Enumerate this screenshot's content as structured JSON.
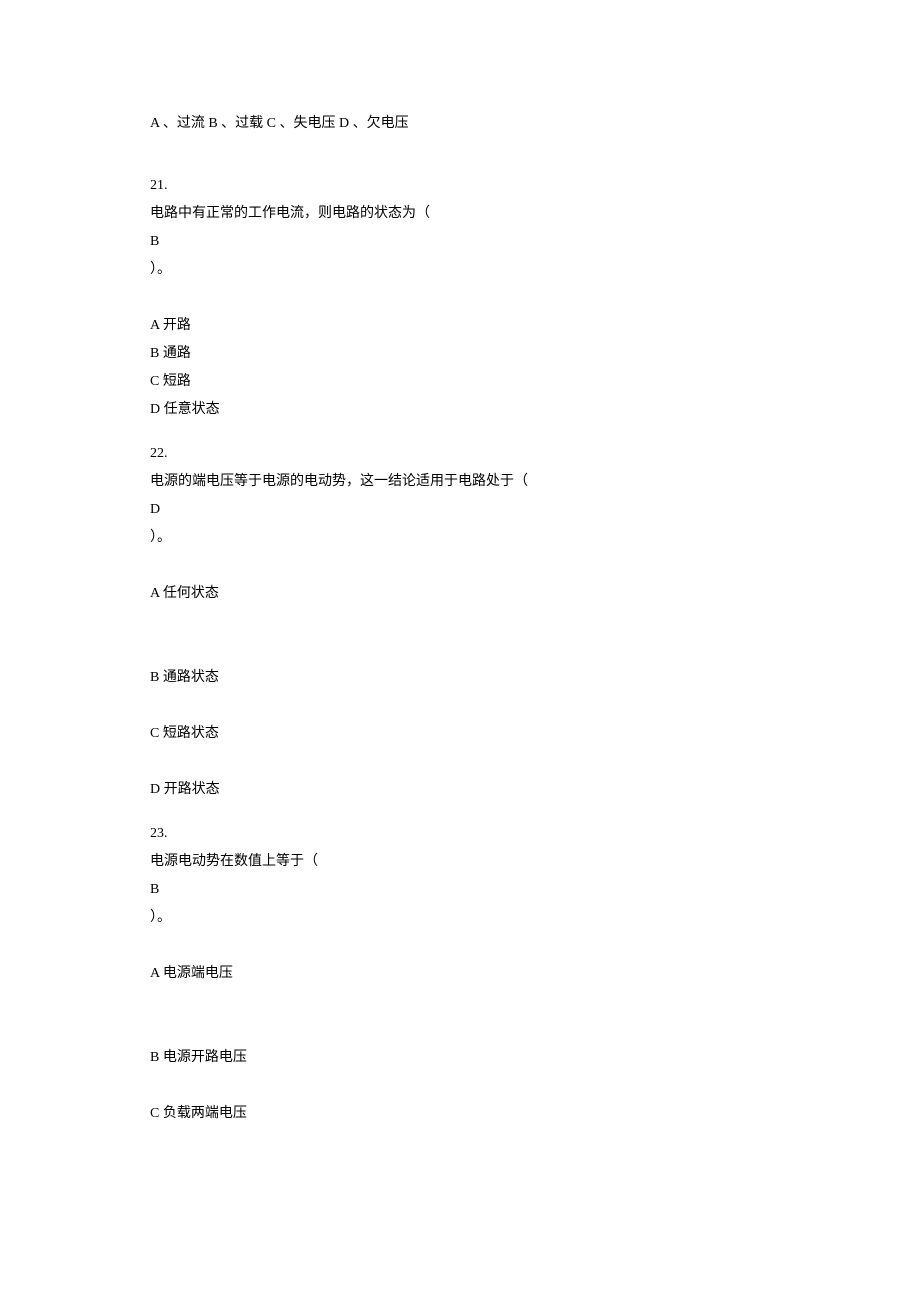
{
  "q20": {
    "options_line": "A 、过流  B 、过载  C 、失电压  D 、欠电压"
  },
  "q21": {
    "num": "21.",
    "stem": "电路中有正常的工作电流，则电路的状态为（",
    "answer": "B",
    "close": "）。",
    "optA": "A 开路",
    "optB": "B 通路",
    "optC": "C 短路",
    "optD": "D 任意状态"
  },
  "q22": {
    "num": "22.",
    "stem": "电源的端电压等于电源的电动势，这一结论适用于电路处于（",
    "answer": "D",
    "close": "）。",
    "optA": "A 任何状态",
    "optB": "B 通路状态",
    "optC": "C 短路状态",
    "optD": "D 开路状态"
  },
  "q23": {
    "num": "23.",
    "stem": "电源电动势在数值上等于（",
    "answer": "B",
    "close": "）。",
    "optA": "A 电源端电压",
    "optB": "B 电源开路电压",
    "optC": "C 负载两端电压"
  }
}
